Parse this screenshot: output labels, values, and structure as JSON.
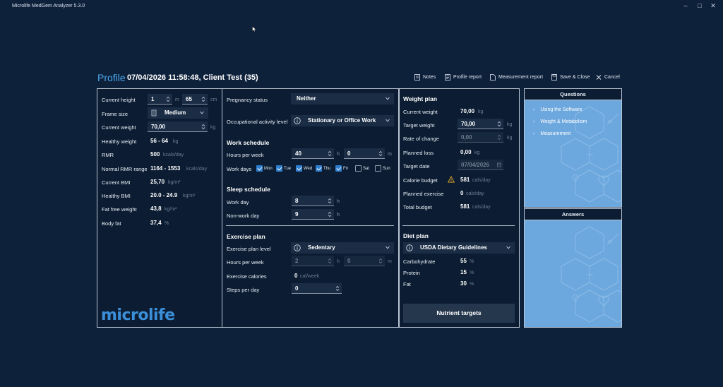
{
  "window": {
    "title": "Microlife MedGem Analyzer 5.3.0"
  },
  "header": {
    "title": "Profile",
    "subtitle": "07/04/2026 11:58:48, Client Test (35)"
  },
  "toolbar": {
    "notes": "Notes",
    "profile_report": "Profile report",
    "measurement_report": "Measurement report",
    "save_close": "Save & Close",
    "cancel": "Cancel"
  },
  "body": {
    "current_height_label": "Current height",
    "height_m": "1",
    "height_m_unit": "m",
    "height_cm": "65",
    "height_cm_unit": "cm",
    "frame_size_label": "Frame size",
    "frame_size": "Medium",
    "current_weight_label": "Current weight",
    "current_weight": "70,00",
    "weight_unit": "kg",
    "healthy_weight_label": "Healthy weight",
    "healthy_weight": "56 - 64",
    "healthy_weight_unit": "kg",
    "rmr_label": "RMR",
    "rmr": "500",
    "rmr_unit": "kcals/day",
    "rmr_range_label": "Normal RMR range",
    "rmr_range": "1164 - 1553",
    "rmr_range_unit": "kcals/day",
    "bmi_label": "Current BMI",
    "bmi": "25,70",
    "bmi_unit": "kg/m²",
    "healthy_bmi_label": "Healthy BMI",
    "healthy_bmi": "20.0 - 24.9",
    "healthy_bmi_unit": "kg/m²",
    "ffw_label": "Fat free weight",
    "ffw": "43,8",
    "ffw_unit": "kg/m²",
    "body_fat_label": "Body fat",
    "body_fat": "37,4",
    "body_fat_unit": "%",
    "logo": "microlife"
  },
  "lifestyle": {
    "pregnancy_label": "Pregnancy status",
    "pregnancy": "Neither",
    "occupation_label": "Occupational activity level",
    "occupation": "Stationary or Office Work",
    "work_title": "Work schedule",
    "work_hours_label": "Hours per week",
    "work_hours_h": "40",
    "work_hours_m": "0",
    "h_unit": "h",
    "m_unit": "m",
    "work_days_label": "Work days",
    "days": [
      {
        "label": "Mon",
        "checked": true
      },
      {
        "label": "Tue",
        "checked": true
      },
      {
        "label": "Wed",
        "checked": true
      },
      {
        "label": "Thu",
        "checked": true
      },
      {
        "label": "Fri",
        "checked": true
      },
      {
        "label": "Sat",
        "checked": false
      },
      {
        "label": "Sun",
        "checked": false
      }
    ],
    "sleep_title": "Sleep schedule",
    "work_day_label": "Work day",
    "work_day_sleep": "8",
    "nonwork_day_label": "Non-work day",
    "nonwork_day_sleep": "9",
    "exercise_title": "Exercise plan",
    "exercise_level_label": "Exercise plan level",
    "exercise_level": "Sedentary",
    "ex_hours_label": "Hours per week",
    "ex_hours_h": "2",
    "ex_hours_m": "0",
    "ex_cal_label": "Exercise calories",
    "ex_cal": "0",
    "ex_cal_unit": "cal/week",
    "steps_label": "Steps per day",
    "steps": "0"
  },
  "weight_plan": {
    "title": "Weight plan",
    "current_weight_label": "Current weight",
    "current_weight": "70,00",
    "kg": "kg",
    "target_weight_label": "Target weight",
    "target_weight": "70,00",
    "rate_label": "Rate of change",
    "rate": "0,00",
    "planned_loss_label": "Planned loss",
    "planned_loss": "0,00",
    "target_date_label": "Target date",
    "target_date": "07/04/2026",
    "calorie_budget_label": "Calorie budget",
    "calorie_budget": "581",
    "cal_unit": "cals/day",
    "planned_ex_label": "Planned exercise",
    "planned_ex": "0",
    "total_budget_label": "Total budget",
    "total_budget": "581",
    "diet_title": "Diet plan",
    "diet": "USDA Dietary Guidelines",
    "carb_label": "Carbohydrate",
    "carb": "55",
    "protein_label": "Protein",
    "protein": "15",
    "fat_label": "Fat",
    "fat": "30",
    "pct": "%",
    "nutrient_button": "Nutrient targets",
    "warning_color": "#e0a526"
  },
  "questions": {
    "title": "Questions",
    "items": [
      "Using the Software",
      "Weight & Metabolism",
      "Measurement"
    ]
  },
  "answers": {
    "title": "Answers"
  }
}
